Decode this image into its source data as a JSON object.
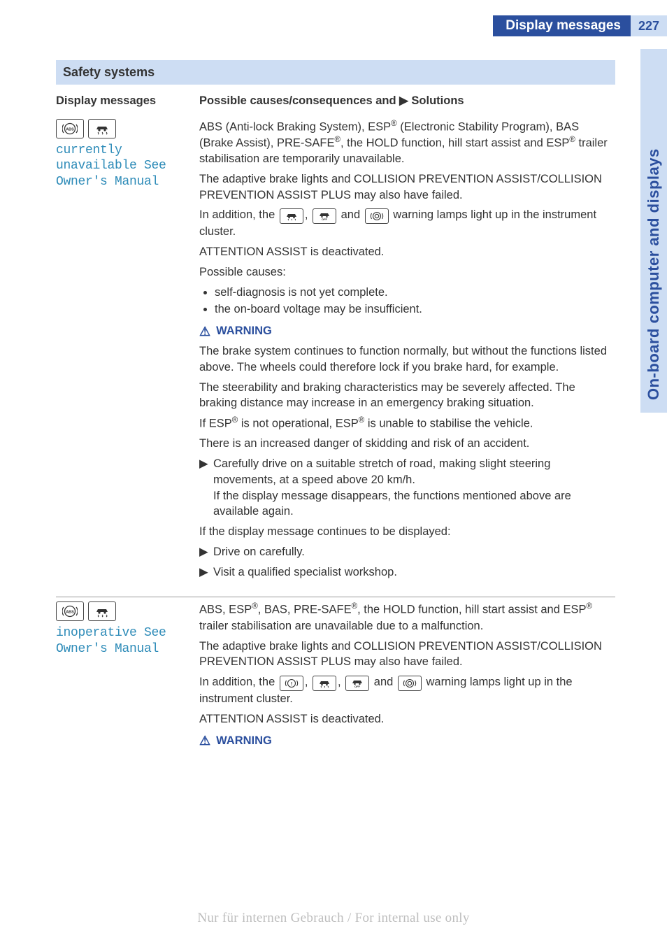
{
  "header": {
    "title": "Display messages",
    "page_number": "227"
  },
  "side_tab": "On-board computer and displays",
  "section_header": "Safety systems",
  "table": {
    "col1_header": "Display messages",
    "col2_header_pre": "Possible causes/consequences and ",
    "col2_header_post": " Solutions"
  },
  "icons": {
    "abs": "ABS",
    "car_skid": "car-skid-icon",
    "car_warn": "car-warn-icon",
    "car_off": "car-off-icon",
    "brake_circle": "brake-circle-icon",
    "info_circle": "info-circle-icon"
  },
  "row1": {
    "display_text": "currently unavailable See Owner's Manual",
    "p1a": "ABS (Anti-lock Braking System), ESP",
    "p1b": " (Electronic Stability Program), BAS (Brake Assist), PRE-SAFE",
    "p1c": ", the HOLD function, hill start assist and ESP",
    "p1d": " trailer stabilisation are temporarily unavailable.",
    "p2": "The adaptive brake lights and COLLISION PREVENTION ASSIST/COLLISION PREVENTION ASSIST PLUS may also have failed.",
    "p3a": "In addition, the ",
    "p3b": " and ",
    "p3c": " warning lamps light up in the instrument cluster.",
    "p4": "ATTENTION ASSIST is deactivated.",
    "p5": "Possible causes:",
    "b1": "self-diagnosis is not yet complete.",
    "b2": "the on-board voltage may be insufficient.",
    "warn_label": "WARNING",
    "w1": "The brake system continues to function normally, but without the functions listed above. The wheels could therefore lock if you brake hard, for example.",
    "w2": "The steerability and braking characteristics may be severely affected. The braking distance may increase in an emergency braking situation.",
    "w3a": "If ESP",
    "w3b": " is not operational, ESP",
    "w3c": " is unable to stabilise the vehicle.",
    "w4": "There is an increased danger of skidding and risk of an accident.",
    "s1a": "Carefully drive on a suitable stretch of road, making slight steering movements, at a speed above 20 km/h.",
    "s1b": "If the display message disappears, the functions mentioned above are available again.",
    "p6": "If the display message continues to be displayed:",
    "s2": "Drive on carefully.",
    "s3": "Visit a qualified specialist workshop."
  },
  "row2": {
    "display_text": "inoperative See Owner's Manual",
    "p1a": "ABS, ESP",
    "p1b": ", BAS, PRE-SAFE",
    "p1c": ", the HOLD function, hill start assist and ESP",
    "p1d": " trailer stabilisation are unavailable due to a malfunction.",
    "p2": "The adaptive brake lights and COLLISION PREVENTION ASSIST/COLLISION PREVENTION ASSIST PLUS may also have failed.",
    "p3a": "In addition, the ",
    "p3b": " and ",
    "p3c": " warning lamps light up in the instrument cluster.",
    "p4": "ATTENTION ASSIST is deactivated.",
    "warn_label": "WARNING"
  },
  "footer": "Nur für internen Gebrauch / For internal use only",
  "glyphs": {
    "solid_right_triangle": "▶",
    "warning_triangle": "⚠"
  }
}
